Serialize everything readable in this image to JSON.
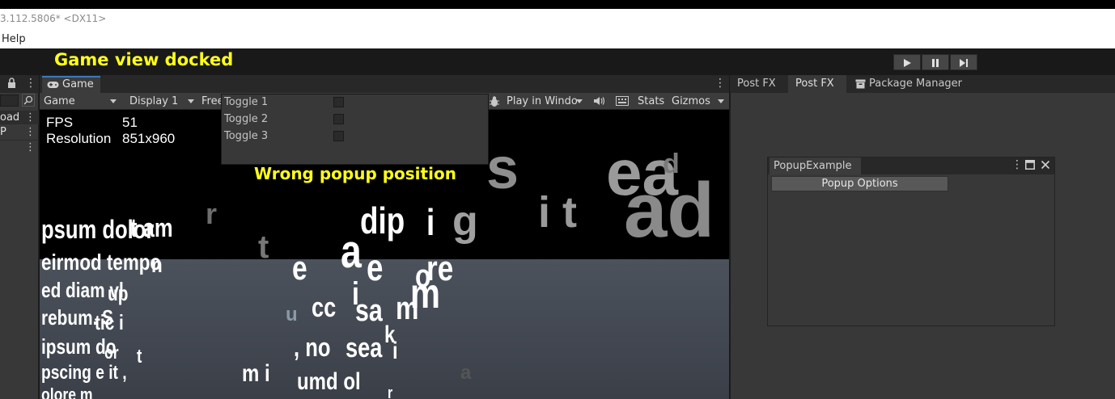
{
  "window": {
    "title": "3.112.5806* <DX11>",
    "menu_help": "Help"
  },
  "annotations": {
    "docked": "Game view docked",
    "wrong_popup": "Wrong popup position"
  },
  "left_panel": {
    "item_load": "oad",
    "item_p": "P"
  },
  "game": {
    "tab_label": "Game",
    "mode_dropdown": "Game",
    "display_dropdown": "Display 1",
    "aspect_dropdown": "Free",
    "play_mode_dropdown": "Play in Windo",
    "stats_button": "Stats",
    "gizmos_button": "Gizmos",
    "fps_label": "FPS",
    "fps_value": "51",
    "resolution_label": "Resolution",
    "resolution_value": "851x960"
  },
  "popup": {
    "toggles": [
      "Toggle 1",
      "Toggle 2",
      "Toggle 3"
    ]
  },
  "right_tabs": [
    "Post FX",
    "Post FX",
    "Package Manager"
  ],
  "popup_example": {
    "title": "PopupExample",
    "button": "Popup Options"
  },
  "scene_text": {
    "w1": "psum dolor",
    "w2": "t am",
    "w3": "eirmod tempo",
    "w4": "n",
    "w5": "ed diam vl",
    "w6": "up",
    "w7": "rebum. S",
    "w8": "tic i",
    "w9": "ipsum do",
    "w10": "or",
    "w11": "t",
    "w12": "pscing e it ,",
    "w13": "olore m",
    "w14": "dip",
    "w15": "i",
    "w16": "g",
    "w17": "r",
    "w18": "i t",
    "w19": "e",
    "w20": "a",
    "w21": "e",
    "w22": "o",
    "w23": "re",
    "w24": "i",
    "w25": "m",
    "w26": "cc",
    "w27": "sa",
    "w28": "m",
    "w29": "u",
    "w30": ", no",
    "w31": "sea",
    "w32": "k",
    "w33": "i",
    "w34": "m i",
    "w35": "umd ol",
    "w36": "r",
    "w37": "s",
    "w38": "ea",
    "w39": "ad",
    "w40": "d",
    "w41": "a"
  }
}
